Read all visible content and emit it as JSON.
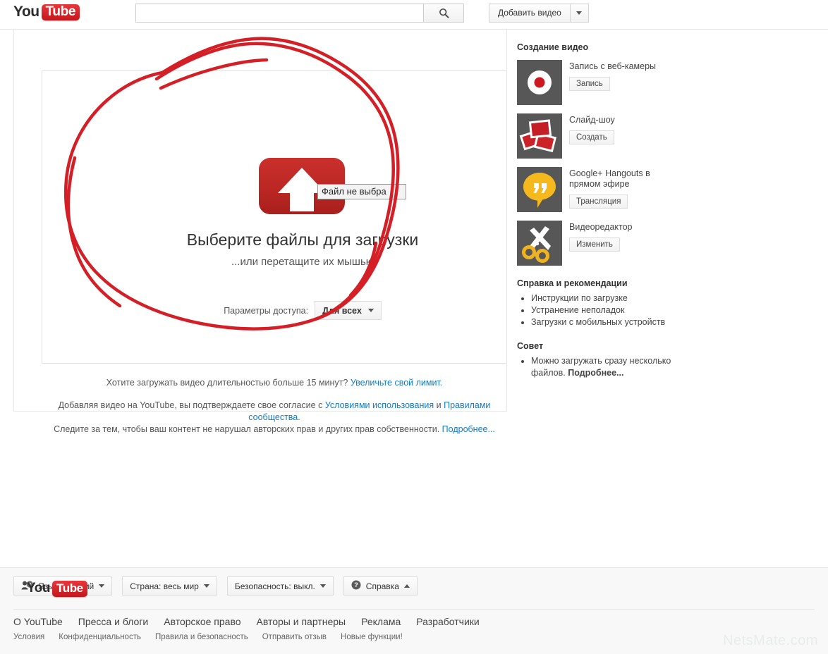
{
  "header": {
    "logo_you": "You",
    "logo_tube": "Tube",
    "search_value": "",
    "search_placeholder": "",
    "search_icon": "search-icon",
    "upload_button": "Добавить видео",
    "upload_caret_icon": "chevron-down-icon"
  },
  "upload": {
    "icon": "upload-arrow-icon",
    "title": "Выберите файлы для загрузки",
    "subtitle": "...или перетащите их мышью",
    "privacy_label": "Параметры доступа:",
    "privacy_value": "Для всех",
    "privacy_caret_icon": "chevron-down-icon",
    "file_tooltip": "Файл не выбра",
    "limit_prefix": "Хотите загружать видео длительностью больше 15 минут? ",
    "limit_link": "Увеличьте свой лимит.",
    "legal_line1_a": "Добавляя видео на YouTube, вы подтверждаете свое согласие с ",
    "legal_link_terms": "Условиями использования",
    "legal_line1_b": " и ",
    "legal_link_community": "Правилами сообщества.",
    "legal_line2_a": "Следите за тем, чтобы ваш контент не нарушал авторских прав и других прав собственности. ",
    "legal_link_more": "Подробнее..."
  },
  "sidebar": {
    "heading": "Создание видео",
    "cards": [
      {
        "icon": "webcam-record-icon",
        "title": "Запись с веб-камеры",
        "button": "Запись"
      },
      {
        "icon": "slideshow-photos-icon",
        "title": "Слайд-шоу",
        "button": "Создать"
      },
      {
        "icon": "hangouts-icon",
        "title": "Google+ Hangouts в прямом эфире",
        "button": "Трансляция"
      },
      {
        "icon": "scissors-icon",
        "title": "Видеоредактор",
        "button": "Изменить"
      }
    ],
    "help_heading": "Справка и рекомендации",
    "help_items": [
      "Инструкции по загрузке",
      "Устранение неполадок",
      "Загрузки с мобильных устройств"
    ],
    "tip_heading": "Совет",
    "tip_text": "Можно загружать сразу несколько файлов. ",
    "tip_link": "Подробнее..."
  },
  "footer": {
    "logo_you": "You",
    "logo_tube": "Tube",
    "language_icon": "person-question-icon",
    "language": "Язык: Русский",
    "country": "Страна: весь мир",
    "safety": "Безопасность: выкл.",
    "help_icon": "question-circle-icon",
    "help": "Справка",
    "links_primary": [
      "О YouTube",
      "Пресса и блоги",
      "Авторское право",
      "Авторы и партнеры",
      "Реклама",
      "Разработчики"
    ],
    "links_secondary": [
      "Условия",
      "Конфиденциальность",
      "Правила и безопасность",
      "Отправить отзыв",
      "Новые функции!"
    ],
    "watermark": "NetsMate.com"
  },
  "colors": {
    "brand_red": "#cc181e",
    "link_blue": "#167ac6",
    "annotation_red": "#d41f26",
    "thumb_bg": "#575757"
  }
}
